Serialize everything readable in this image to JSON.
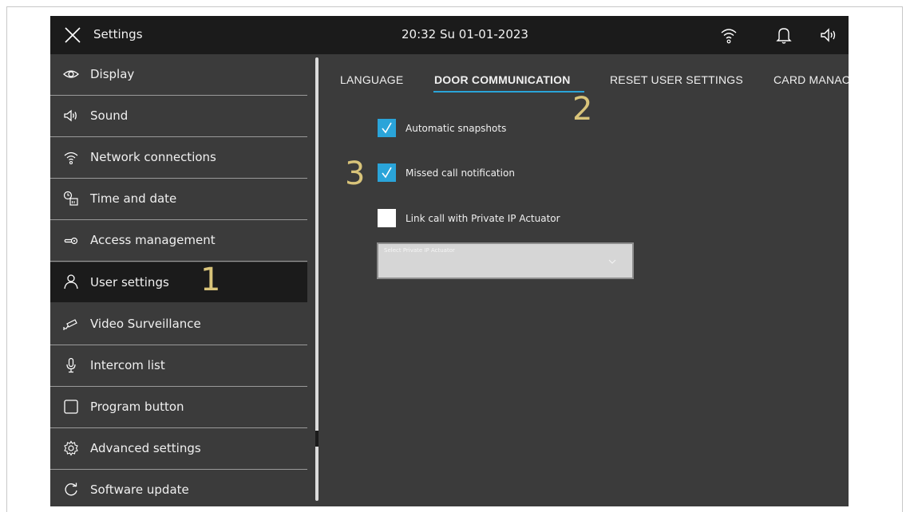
{
  "topbar": {
    "title": "Settings",
    "datetime": "20:32  Su 01-01-2023",
    "icons": [
      "close-icon",
      "wifi-icon",
      "bell-icon",
      "speaker-icon"
    ]
  },
  "sidebar": {
    "items": [
      {
        "label": "Display",
        "icon": "eye-icon"
      },
      {
        "label": "Sound",
        "icon": "speaker-icon"
      },
      {
        "label": "Network connections",
        "icon": "wifi-icon"
      },
      {
        "label": "Time and date",
        "icon": "clock-calendar-icon"
      },
      {
        "label": "Access  management",
        "icon": "key-icon"
      },
      {
        "label": "User settings",
        "icon": "user-icon",
        "active": true
      },
      {
        "label": "Video Surveillance",
        "icon": "camera-icon"
      },
      {
        "label": "Intercom list",
        "icon": "microphone-icon"
      },
      {
        "label": "Program button",
        "icon": "square-button-icon"
      },
      {
        "label": "Advanced settings",
        "icon": "gear-icon"
      },
      {
        "label": "Software update",
        "icon": "refresh-icon"
      }
    ]
  },
  "tabs": [
    {
      "label": "LANGUAGE"
    },
    {
      "label": "DOOR COMMUNICATION",
      "active": true
    },
    {
      "label": "RESET USER SETTINGS"
    },
    {
      "label": "CARD MANAC"
    }
  ],
  "options": [
    {
      "label": "Automatic snapshots",
      "checked": true
    },
    {
      "label": "Missed call notification",
      "checked": true
    },
    {
      "label": "Link call with Private  IP Actuator",
      "checked": false
    }
  ],
  "actuator_select": {
    "placeholder": "Select Private IP Actuator"
  },
  "callouts": [
    "1",
    "2",
    "3"
  ],
  "colors": {
    "accent": "#2aa4d9",
    "topbar": "#1b1b1b",
    "background": "#3b3b3b",
    "callout": "#d9c47a"
  }
}
